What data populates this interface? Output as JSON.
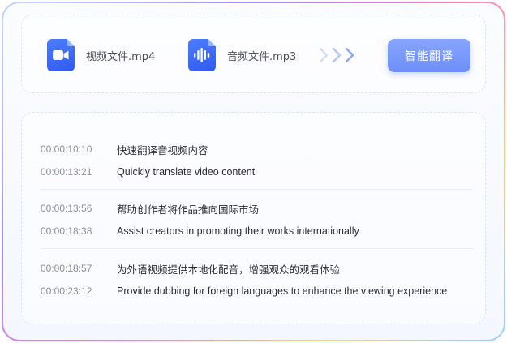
{
  "files": [
    {
      "name": "视频文件.mp4",
      "icon": "video-camera-icon"
    },
    {
      "name": "音频文件.mp3",
      "icon": "audio-waveform-icon"
    }
  ],
  "action": {
    "label": "智能翻译"
  },
  "colors": {
    "accent": "#2f5bf0",
    "button": "#7f9cfb",
    "arrow": "#b8c8f5"
  },
  "subtitles": [
    {
      "source": {
        "time": "00:00:10:10",
        "text": "快速翻译音视频内容"
      },
      "target": {
        "time": "00:00:13:21",
        "text": "Quickly translate video content"
      }
    },
    {
      "source": {
        "time": "00:00:13:56",
        "text": "帮助创作者将作品推向国际市场"
      },
      "target": {
        "time": "00:00:18:38",
        "text": "Assist creators in promoting their works internationally"
      }
    },
    {
      "source": {
        "time": "00:00:18:57",
        "text": "为外语视频提供本地化配音，增强观众的观看体验"
      },
      "target": {
        "time": "00:00:23:12",
        "text": "Provide dubbing for foreign languages to enhance the viewing experience"
      }
    }
  ]
}
